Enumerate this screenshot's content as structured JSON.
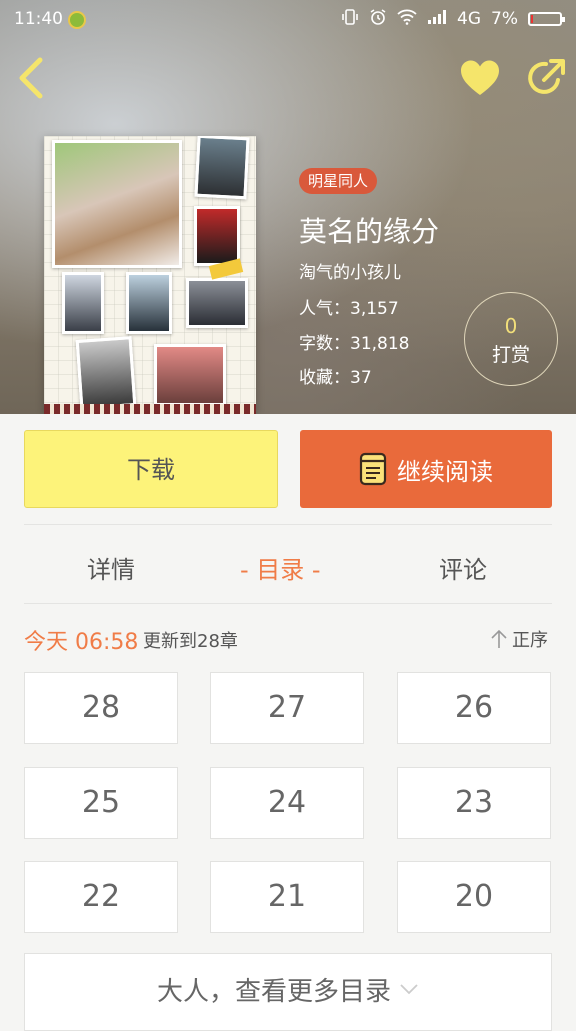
{
  "status_bar": {
    "time": "11:40",
    "network": "4G",
    "battery_text": "7%",
    "battery_level": 0.07
  },
  "book": {
    "tag": "明星同人",
    "title": "莫名的缘分",
    "author": "淘气的小孩儿",
    "popularity": "人气：3,157",
    "word_count": "字数：31,818",
    "favorites": "收藏：37",
    "tip_count": "0",
    "tip_label": "打赏"
  },
  "actions": {
    "download": "下载",
    "continue_reading": "继续阅读"
  },
  "tabs": [
    {
      "label": "详情"
    },
    {
      "label": "- 目录 -"
    },
    {
      "label": "评论"
    }
  ],
  "catalog": {
    "update_time": "今天 06:58",
    "update_text": "更新到28章",
    "sort_label": "正序",
    "chapters": [
      "28",
      "27",
      "26",
      "25",
      "24",
      "23",
      "22",
      "21",
      "20"
    ],
    "more_label": "大人，查看更多目录"
  },
  "colors": {
    "accent": "#e96a3b",
    "download_bg": "#fdf37a",
    "tag_bg": "#d9593b",
    "icon_yellow": "#f5e56b"
  }
}
